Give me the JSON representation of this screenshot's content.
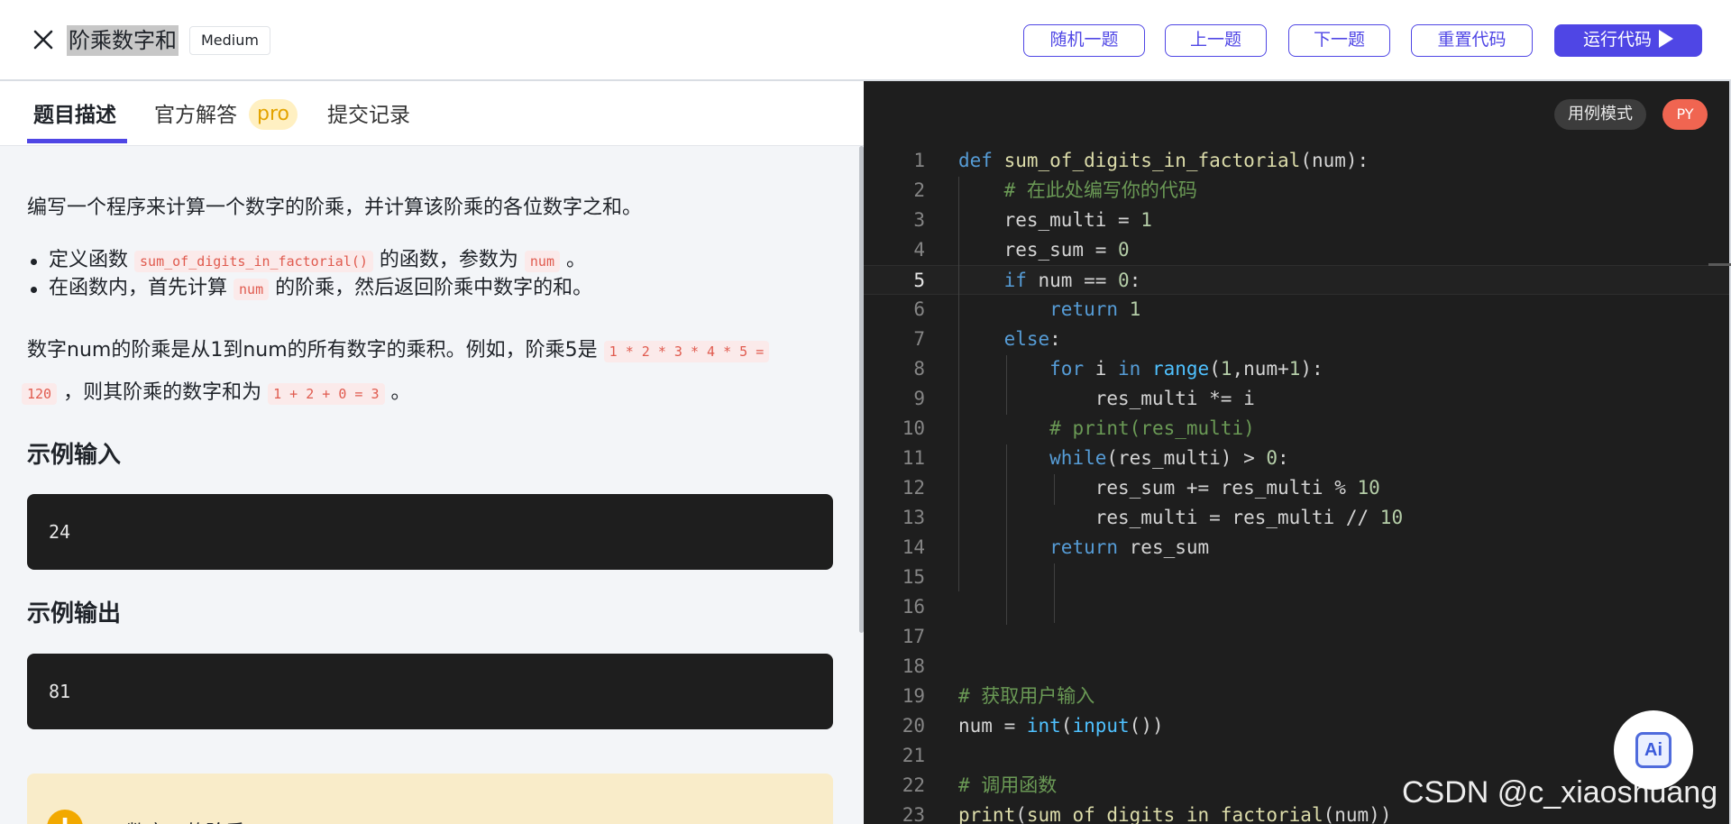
{
  "header": {
    "title": "阶乘数字和",
    "difficulty": "Medium",
    "buttons": {
      "random": "随机一题",
      "prev": "上一题",
      "next": "下一题",
      "reset": "重置代码",
      "run": "运行代码"
    }
  },
  "tabs": {
    "description": "题目描述",
    "solution": "官方解答",
    "pro": "pro",
    "submissions": "提交记录"
  },
  "problem": {
    "intro": "编写一个程序来计算一个数字的阶乘，并计算该阶乘的各位数字之和。",
    "bullet1_a": "定义函数",
    "bullet1_code": "sum_of_digits_in_factorial()",
    "bullet1_b": "的函数，参数为",
    "bullet1_code2": "num",
    "bullet1_c": "。",
    "bullet2_a": "在函数内，首先计算",
    "bullet2_code": "num",
    "bullet2_b": "的阶乘，然后返回阶乘中数字的和。",
    "example_a": "数字num的阶乘是从1到num的所有数字的乘积。例如，阶乘5是",
    "example_code1": "1 * 2 * 3 * 4 * 5 =",
    "example_code1b": "120",
    "example_b": "，则其阶乘的数字和为",
    "example_code2": "1 + 2 + 0 = 3",
    "example_c": "。",
    "sample_input_title": "示例输入",
    "sample_input": "24",
    "sample_output_title": "示例输出",
    "sample_output": "81",
    "hint_icon": "!",
    "hint_text": "数字…的阶乘…"
  },
  "editor": {
    "mode": "用例模式",
    "lang": "PY",
    "current_line": 5
  },
  "ai_button": "Ai",
  "watermark": "CSDN @c_xiaoshuang"
}
